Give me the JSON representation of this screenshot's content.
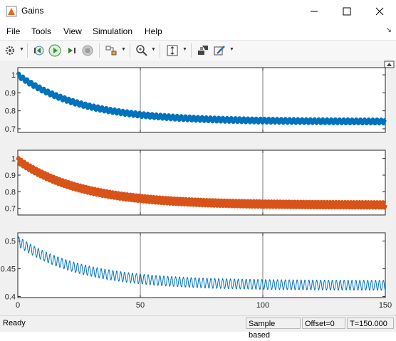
{
  "window": {
    "title": "Gains"
  },
  "menu": [
    "File",
    "Tools",
    "View",
    "Simulation",
    "Help"
  ],
  "toolbar": {
    "icons": [
      "gear-icon",
      "step-back-icon",
      "run-icon",
      "step-forward-icon",
      "stop-icon",
      "signal-select-icon",
      "zoom-icon",
      "autoscale-icon",
      "highlight-block-icon",
      "style-icon"
    ]
  },
  "chart_data": [
    {
      "type": "line",
      "x_range": [
        0,
        150
      ],
      "ylim": [
        0.68,
        1.04
      ],
      "yticks": [
        "0.7",
        "0.8",
        "0.9",
        "1"
      ],
      "series": [
        {
          "color": "#0072BD",
          "start": 1.0,
          "final": 0.74,
          "tau": 26,
          "amp": 0.012,
          "period": 1.7,
          "stroke": 5
        }
      ]
    },
    {
      "type": "line",
      "x_range": [
        0,
        150
      ],
      "ylim": [
        0.66,
        1.05
      ],
      "yticks": [
        "0.7",
        "0.8",
        "0.9",
        "1"
      ],
      "series": [
        {
          "color": "#D95319",
          "start": 0.99,
          "final": 0.72,
          "tau": 26,
          "amp": 0.018,
          "period": 1.2,
          "stroke": 5
        }
      ]
    },
    {
      "type": "line",
      "x_range": [
        0,
        150
      ],
      "ylim": [
        0.398,
        0.515
      ],
      "yticks": [
        "0.4",
        "0.45",
        "0.5"
      ],
      "series": [
        {
          "color": "#0072BD",
          "start": 0.5,
          "final": 0.42,
          "tau": 26,
          "amp": 0.009,
          "period": 1.6,
          "stroke": 1
        }
      ]
    }
  ],
  "x_ticks": [
    "0",
    "50",
    "100",
    "150"
  ],
  "status": {
    "ready": "Ready",
    "mode": "Sample based",
    "offset": "Offset=0",
    "time": "T=150.000"
  }
}
